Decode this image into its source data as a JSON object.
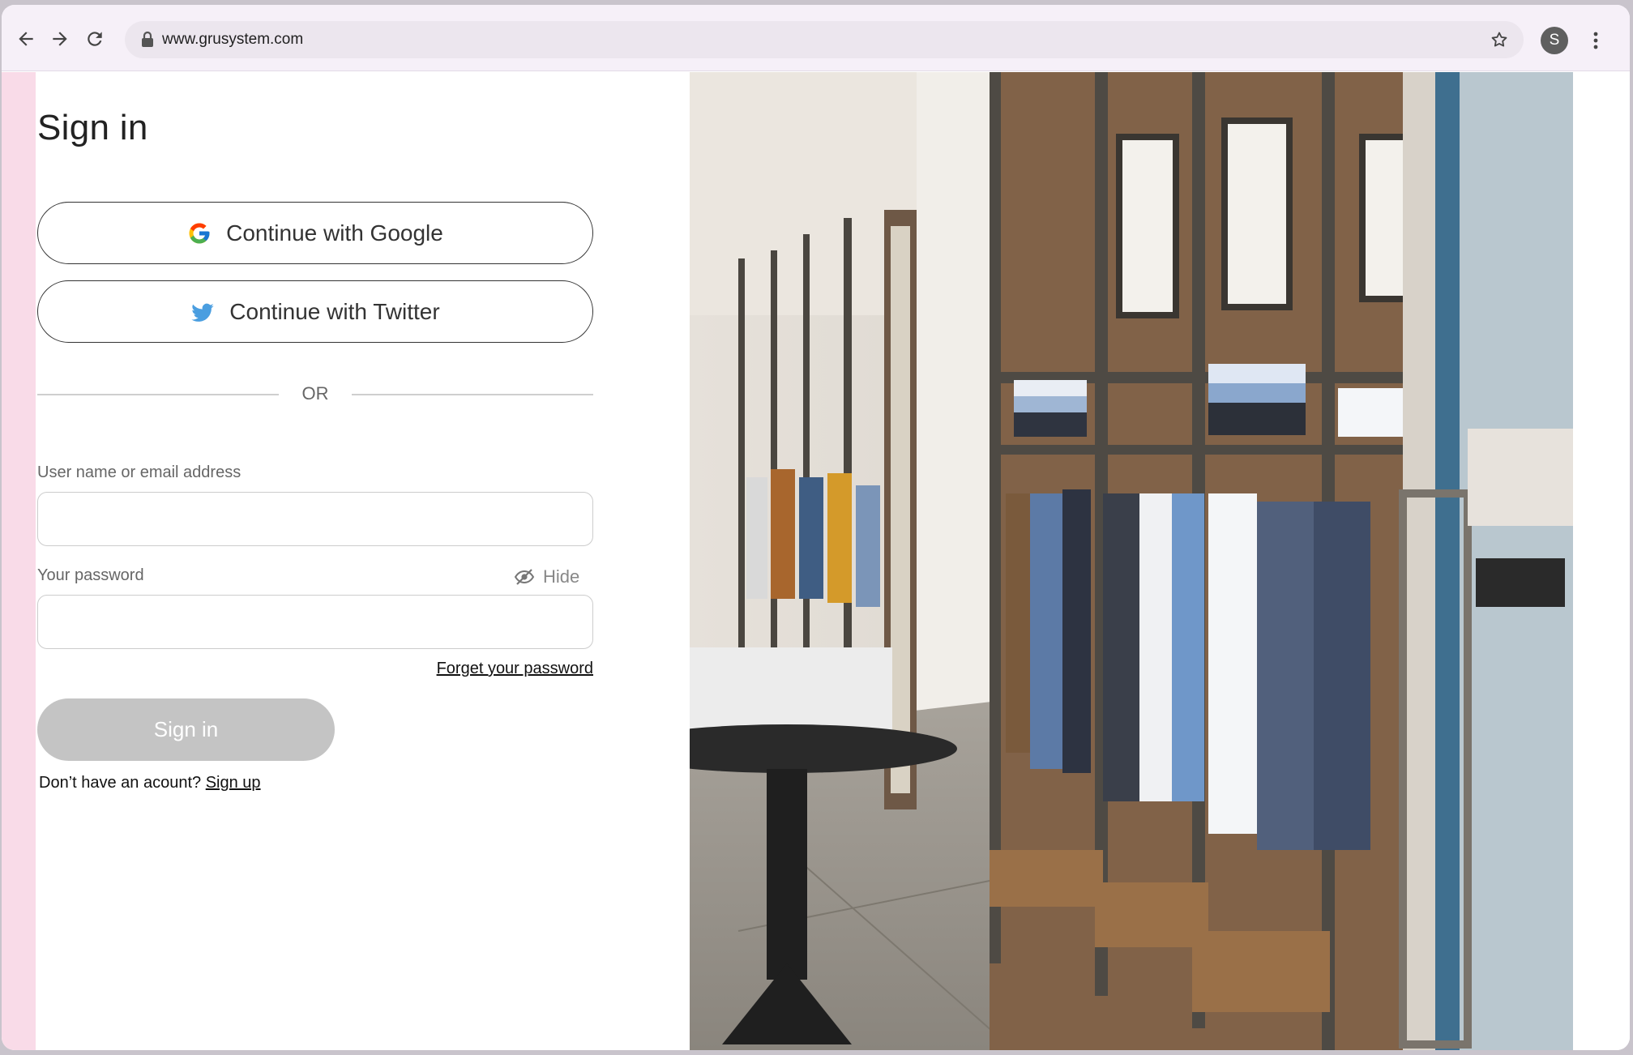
{
  "browser": {
    "url": "www.grusystem.com",
    "profile_initial": "S",
    "icons": {
      "back": "arrow-left-icon",
      "forward": "arrow-right-icon",
      "reload": "reload-icon",
      "lock": "lock-icon",
      "bookmark": "star-icon",
      "menu": "kebab-menu-icon"
    }
  },
  "signin": {
    "title": "Sign in",
    "google_label": "Continue with Google",
    "twitter_label": "Continue with Twitter",
    "divider_text": "OR",
    "username_label": "User name or email address",
    "username_value": "",
    "password_label": "Your password",
    "password_value": "",
    "hide_label": "Hide",
    "forgot_label": "Forget your password",
    "submit_label": "Sign in",
    "no_account_text": "Don’t have an acount?",
    "signup_label": "Sign up"
  },
  "colors": {
    "accent_strip": "#f9dbe8",
    "button_disabled": "#c4c4c4",
    "twitter_blue": "#4a9ee0",
    "toolbar_bg": "#f6f0f8"
  }
}
